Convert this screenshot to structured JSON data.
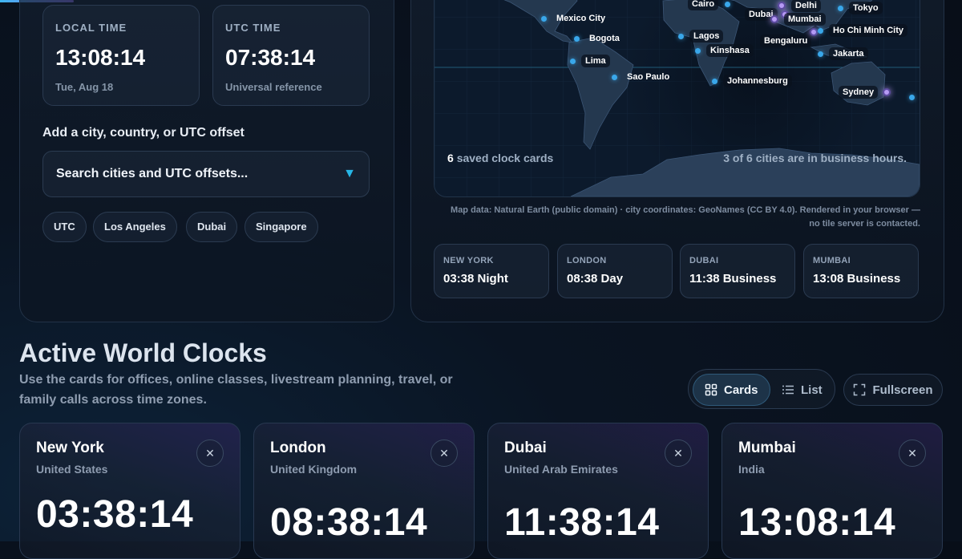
{
  "local_time": {
    "label": "LOCAL TIME",
    "value": "13:08:14",
    "sub": "Tue, Aug 18"
  },
  "utc_time": {
    "label": "UTC TIME",
    "value": "07:38:14",
    "sub": "Universal reference"
  },
  "search": {
    "label": "Add a city, country, or UTC offset",
    "placeholder": "Search cities and UTC offsets..."
  },
  "quick_chips": [
    "UTC",
    "Los Angeles",
    "Dubai",
    "Singapore"
  ],
  "map": {
    "cities": [
      "Mexico City",
      "Bogota",
      "Lima",
      "Sao Paulo",
      "Cairo",
      "Lagos",
      "Kinshasa",
      "Johannesburg",
      "Dubai",
      "Delhi",
      "Mumbai",
      "Bengaluru",
      "Tokyo",
      "Ho Chi Minh City",
      "Jakarta",
      "Sydney"
    ],
    "saved_count": "6",
    "saved_text": "saved clock cards",
    "business_text": "3 of 6 cities are in business hours.",
    "attribution": "Map data: Natural Earth (public domain) · city coordinates: GeoNames (CC BY 4.0). Rendered in your browser — no tile server is contacted."
  },
  "mini_clocks": [
    {
      "city": "NEW YORK",
      "status": "03:38 Night"
    },
    {
      "city": "LONDON",
      "status": "08:38 Day"
    },
    {
      "city": "DUBAI",
      "status": "11:38 Business"
    },
    {
      "city": "MUMBAI",
      "status": "13:08 Business"
    }
  ],
  "section": {
    "title": "Active World Clocks",
    "description": "Use the cards for offices, online classes, livestream planning, travel, or family calls across time zones."
  },
  "view": {
    "cards_label": "Cards",
    "list_label": "List",
    "fullscreen_label": "Fullscreen"
  },
  "clock_cards": [
    {
      "city": "New York",
      "country": "United States",
      "time": "03:38:14"
    },
    {
      "city": "London",
      "country": "United Kingdom",
      "time": "08:38:14"
    },
    {
      "city": "Dubai",
      "country": "United Arab Emirates",
      "time": "11:38:14"
    },
    {
      "city": "Mumbai",
      "country": "India",
      "time": "13:08:14"
    }
  ],
  "icons": {
    "close": "close-icon",
    "caret": "chevron-down-icon",
    "cards": "grid-icon",
    "list": "list-icon",
    "fullscreen": "fullscreen-icon"
  },
  "colors": {
    "accent": "#27b6e6",
    "city_dot": "#39a7ea",
    "active_dot": "#b69af5"
  }
}
